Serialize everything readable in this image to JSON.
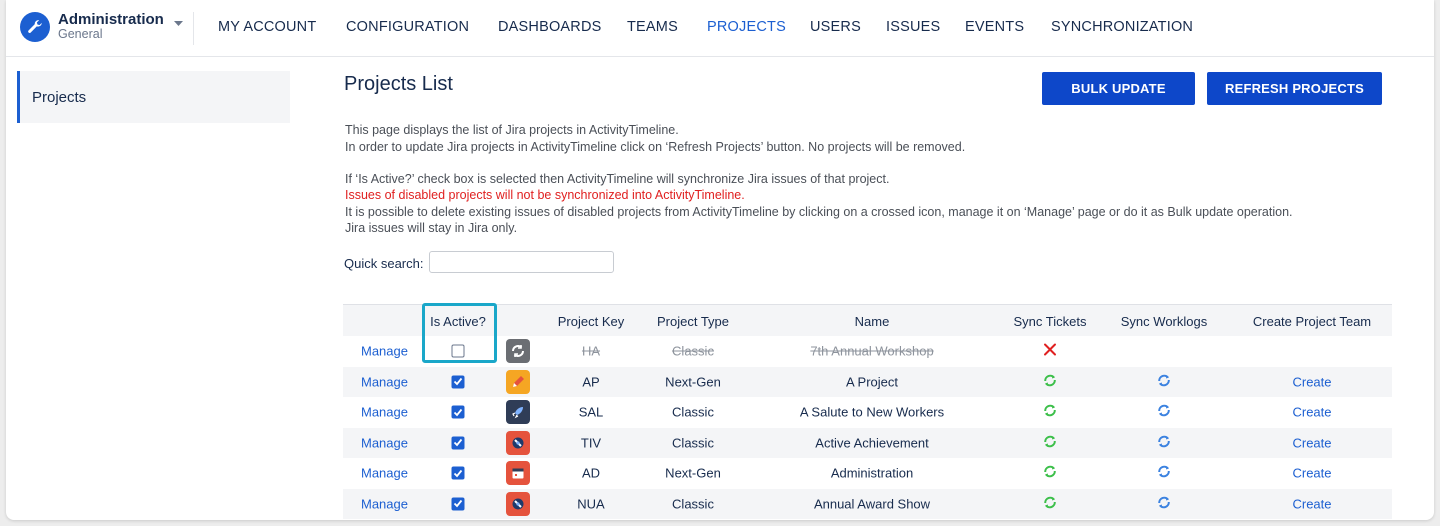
{
  "app": {
    "title": "Administration",
    "subtitle": "General"
  },
  "nav": {
    "items": [
      {
        "label": "MY ACCOUNT",
        "active": false
      },
      {
        "label": "CONFIGURATION",
        "active": false
      },
      {
        "label": "DASHBOARDS",
        "active": false
      },
      {
        "label": "TEAMS",
        "active": false
      },
      {
        "label": "PROJECTS",
        "active": true
      },
      {
        "label": "USERS",
        "active": false
      },
      {
        "label": "ISSUES",
        "active": false
      },
      {
        "label": "EVENTS",
        "active": false
      },
      {
        "label": "SYNCHRONIZATION",
        "active": false
      }
    ]
  },
  "sidebar": {
    "items": [
      {
        "label": "Projects",
        "active": true
      }
    ]
  },
  "main": {
    "title": "Projects List",
    "bulk_update_label": "BULK UPDATE",
    "refresh_label": "REFRESH PROJECTS",
    "description": {
      "line1": "This page displays the list of Jira projects in ActivityTimeline.",
      "line2": "In order to update Jira projects in ActivityTimeline click on ‘Refresh Projects’ button. No projects will be removed.",
      "line3": "If ‘Is Active?’ check box is selected then ActivityTimeline will synchronize Jira issues of that project.",
      "line4_warning": "Issues of disabled projects will not be synchronized into ActivityTimeline.",
      "line5": "It is possible to delete existing issues of disabled projects from ActivityTimeline by clicking on a crossed icon, manage it on ‘Manage’ page or do it as Bulk update operation.",
      "line6": "Jira issues will stay in Jira only."
    },
    "quick_search": {
      "label": "Quick search:",
      "value": "",
      "placeholder": ""
    }
  },
  "table": {
    "headers": {
      "is_active": "Is Active?",
      "project_key": "Project Key",
      "project_type": "Project Type",
      "name": "Name",
      "sync_tickets": "Sync Tickets",
      "sync_worklogs": "Sync Worklogs",
      "create_team": "Create Project Team"
    },
    "rows": [
      {
        "manage": "Manage",
        "active": false,
        "icon": "gear-project-icon",
        "icon_color": "#6b6e73",
        "key": "HA",
        "type": "Classic",
        "name": "7th Annual Workshop",
        "sync_tickets": "disabled",
        "sync_worklogs": "none",
        "create": ""
      },
      {
        "manage": "Manage",
        "active": true,
        "icon": "pencil-project-icon",
        "icon_color": "#f5a623",
        "key": "AP",
        "type": "Next-Gen",
        "name": "A Project",
        "sync_tickets": "on",
        "sync_worklogs": "on",
        "create": "Create"
      },
      {
        "manage": "Manage",
        "active": true,
        "icon": "rocket-project-icon",
        "icon_color": "#2f3d57",
        "key": "SAL",
        "type": "Classic",
        "name": "A Salute to New Workers",
        "sync_tickets": "on",
        "sync_worklogs": "on",
        "create": "Create"
      },
      {
        "manage": "Manage",
        "active": true,
        "icon": "satellite-project-icon",
        "icon_color": "#e5533d",
        "key": "TIV",
        "type": "Classic",
        "name": "Active Achievement",
        "sync_tickets": "on",
        "sync_worklogs": "on",
        "create": "Create"
      },
      {
        "manage": "Manage",
        "active": true,
        "icon": "calendar-project-icon",
        "icon_color": "#e5533d",
        "key": "AD",
        "type": "Next-Gen",
        "name": "Administration",
        "sync_tickets": "on",
        "sync_worklogs": "on",
        "create": "Create"
      },
      {
        "manage": "Manage",
        "active": true,
        "icon": "satellite-project-icon",
        "icon_color": "#e5533d",
        "key": "NUA",
        "type": "Classic",
        "name": "Annual Award Show",
        "sync_tickets": "on",
        "sync_worklogs": "on",
        "create": "Create"
      }
    ]
  },
  "colors": {
    "accent": "#1c5fd1",
    "button": "#0d47c9",
    "warning": "#e02020",
    "sync_tickets": "#3cbf4a",
    "sync_worklogs": "#3b82e0",
    "disabled_x": "#e02020",
    "highlight": "#1aa7c9"
  }
}
